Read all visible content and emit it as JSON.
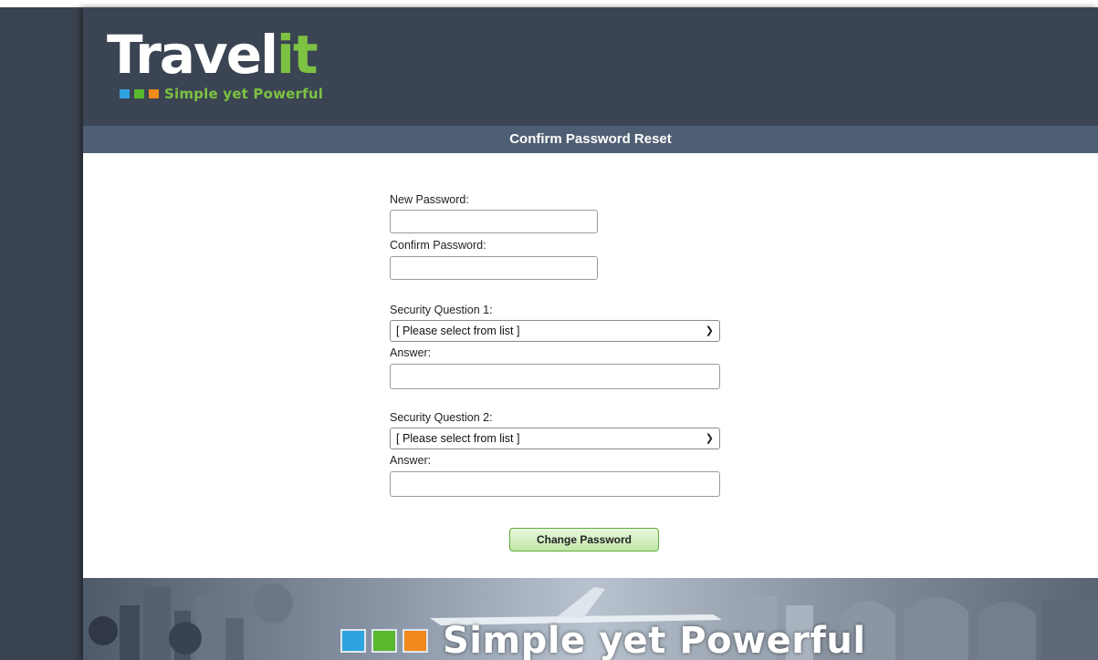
{
  "brand": {
    "logo_main": "Travel",
    "logo_accent": "it",
    "tagline": "Simple yet Powerful"
  },
  "page": {
    "title": "Confirm Password Reset"
  },
  "form": {
    "new_password_label": "New Password:",
    "new_password_value": "",
    "confirm_password_label": "Confirm Password:",
    "confirm_password_value": "",
    "question1_label": "Security Question 1:",
    "question1_selected": "[ Please select from list ]",
    "answer1_label": "Answer:",
    "answer1_value": "",
    "question2_label": "Security Question 2:",
    "question2_selected": "[ Please select from list ]",
    "answer2_label": "Answer:",
    "answer2_value": "",
    "submit_label": "Change Password"
  },
  "banner": {
    "tagline": "Simple yet Powerful"
  },
  "colors": {
    "background": "#3a4350",
    "header": "#3b4453",
    "title_bar": "#4f5f73",
    "brand_green": "#7dc242",
    "brand_blue": "#2fa3e0",
    "brand_orange": "#f08a1c"
  }
}
